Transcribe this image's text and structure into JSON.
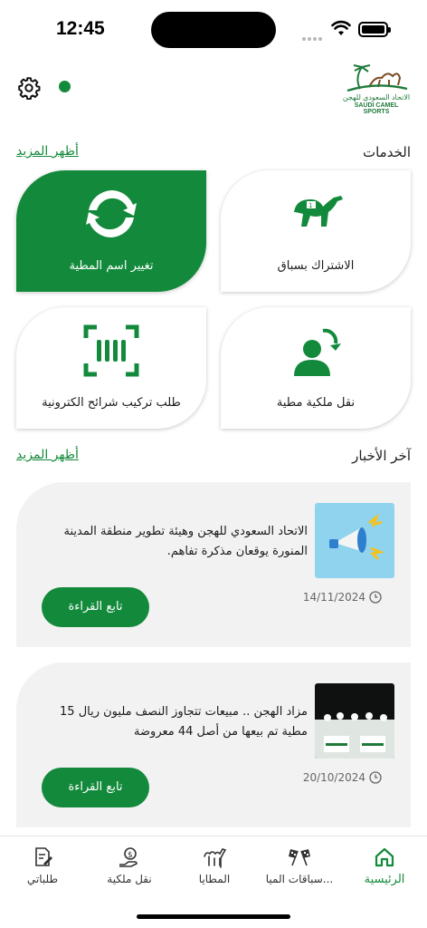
{
  "status_bar": {
    "time": "12:45"
  },
  "header": {
    "logo_text_ar": "الاتحاد السعودي للهجن",
    "logo_text_en": "SAUDI CAMEL SPORTS"
  },
  "services": {
    "title": "الخدمات",
    "more_label": "أظهر المزيد",
    "items": [
      {
        "label": "الاشتراك بسباق",
        "icon": "camel-racing-icon",
        "highlighted": false
      },
      {
        "label": "تغيير اسم المطية",
        "icon": "refresh-icon",
        "highlighted": true
      },
      {
        "label": "نقل ملكية مطية",
        "icon": "user-transfer-icon",
        "highlighted": false
      },
      {
        "label": "طلب تركيب شرائح الكترونية",
        "icon": "chip-scan-icon",
        "highlighted": false
      }
    ]
  },
  "news": {
    "title": "آخر الأخبار",
    "more_label": "أظهر المزيد",
    "items": [
      {
        "headline": "الاتحاد السعودي للهجن وهيئة تطوير منطقة المدينة المنورة يوقعان مذكرة تفاهم.",
        "date": "14/11/2024",
        "read_label": "تابع القراءة",
        "thumb": "megaphone-image"
      },
      {
        "headline": "مزاد الهجن .. مبيعات تتجاوز النصف مليون ريال 15 مطية تم بيعها من أصل 44 معروضة",
        "date": "20/10/2024",
        "read_label": "تابع القراءة",
        "thumb": "auction-photo"
      }
    ]
  },
  "tabbar": {
    "accent": "#138a3b",
    "items": [
      {
        "label": "الرئيسية",
        "icon": "home-icon",
        "active": true
      },
      {
        "label": "سباقات الميا...",
        "icon": "race-flags-icon",
        "active": false
      },
      {
        "label": "المطايا",
        "icon": "camel-icon",
        "active": false
      },
      {
        "label": "نقل ملكية",
        "icon": "money-hand-icon",
        "active": false
      },
      {
        "label": "طلباتي",
        "icon": "document-edit-icon",
        "active": false
      }
    ]
  },
  "colors": {
    "brand_green": "#138a3b",
    "card_gray": "#f2f2f2"
  }
}
